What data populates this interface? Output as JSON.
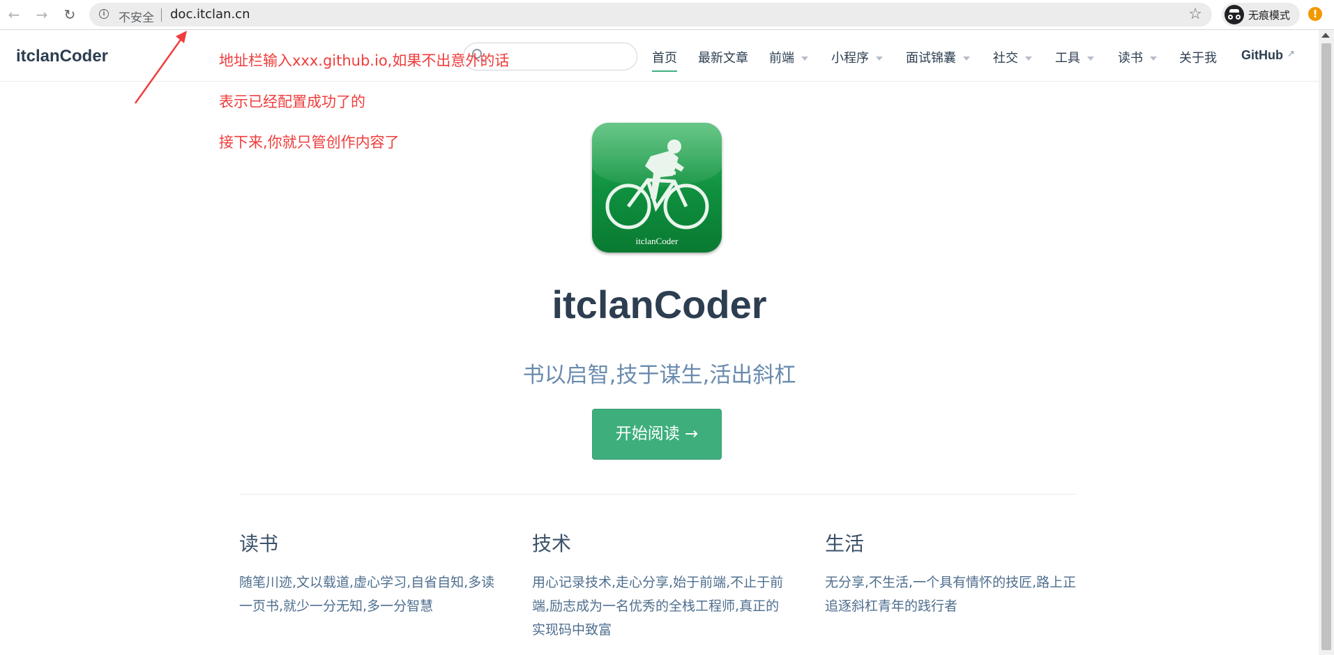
{
  "browser": {
    "back_icon": "arrow-left-icon",
    "forward_icon": "arrow-right-icon",
    "reload_icon": "reload-icon",
    "security_label": "不安全",
    "url": "doc.itclan.cn",
    "incognito_label": "无痕模式",
    "alert_glyph": "!"
  },
  "navbar": {
    "site_name": "itclanCoder",
    "search_placeholder": "",
    "items": [
      {
        "label": "首页",
        "active": true
      },
      {
        "label": "最新文章"
      },
      {
        "label": "前端",
        "dropdown": true
      },
      {
        "label": "小程序",
        "dropdown": true
      },
      {
        "label": "面试锦囊",
        "dropdown": true
      },
      {
        "label": "社交",
        "dropdown": true
      },
      {
        "label": "工具",
        "dropdown": true
      },
      {
        "label": "读书",
        "dropdown": true
      },
      {
        "label": "关于我"
      },
      {
        "label": "GitHub",
        "external": true
      }
    ],
    "accent_color": "#3eaf7c"
  },
  "annotations": {
    "line1": "地址栏输入xxx.github.io,如果不出意外的话",
    "line2": "表示已经配置成功了的",
    "line3": "接下来,你就只管创作内容了",
    "color": "#f03c3c"
  },
  "hero": {
    "logo_text": "itclanCoder",
    "title": "itclanCoder",
    "description": "书以启智,技于谋生,活出斜杠",
    "action_label": "开始阅读 →"
  },
  "features": [
    {
      "title": "读书",
      "details": "随笔川迹,文以载道,虚心学习,自省自知,多读一页书,就少一分无知,多一分智慧"
    },
    {
      "title": "技术",
      "details": "用心记录技术,走心分享,始于前端,不止于前端,励志成为一名优秀的全栈工程师,真正的实现码中致富"
    },
    {
      "title": "生活",
      "details": "无分享,不生活,一个具有情怀的技匠,路上正追逐斜杠青年的践行者"
    }
  ]
}
